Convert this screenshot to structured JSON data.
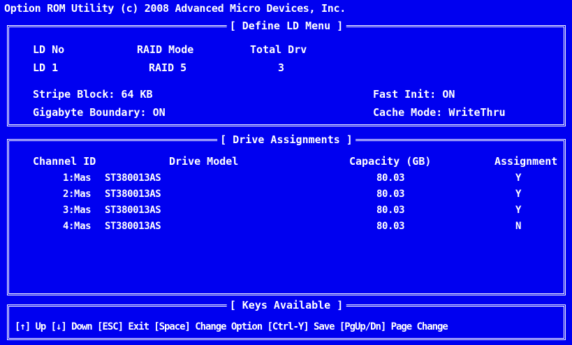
{
  "window": {
    "title": "Option ROM Utility (c) 2008 Advanced Micro Devices, Inc."
  },
  "define_panel": {
    "title": "[ Define LD Menu ]",
    "headers": {
      "ld_no": "LD No",
      "raid_mode": "RAID Mode",
      "total_drv": "Total Drv"
    },
    "values": {
      "ld_no": "LD 1",
      "raid_mode": "RAID 5",
      "total_drv": "3"
    },
    "stripe_block": "Stripe Block: 64 KB",
    "gigabyte_boundary": "Gigabyte Boundary: ON",
    "fast_init": "Fast Init: ON",
    "cache_mode": "Cache Mode: WriteThru"
  },
  "drives_panel": {
    "title": "[ Drive Assignments ]",
    "columns": {
      "channel": "Channel ID",
      "model": "Drive Model",
      "capacity": "Capacity (GB)",
      "assignment": "Assignment"
    },
    "rows": [
      {
        "channel": "1:Mas",
        "model": "ST380013AS",
        "capacity": "80.03",
        "assignment": "Y"
      },
      {
        "channel": "2:Mas",
        "model": "ST380013AS",
        "capacity": "80.03",
        "assignment": "Y"
      },
      {
        "channel": "3:Mas",
        "model": "ST380013AS",
        "capacity": "80.03",
        "assignment": "Y"
      },
      {
        "channel": "4:Mas",
        "model": "ST380013AS",
        "capacity": "80.03",
        "assignment": "N"
      }
    ]
  },
  "keys_panel": {
    "title": "[ Keys Available ]",
    "text": "[↑] Up [↓] Down [ESC] Exit [Space] Change Option [Ctrl-Y] Save [PgUp/Dn] Page Change"
  },
  "colors": {
    "background": "#0000f0",
    "foreground": "#ffffff"
  }
}
